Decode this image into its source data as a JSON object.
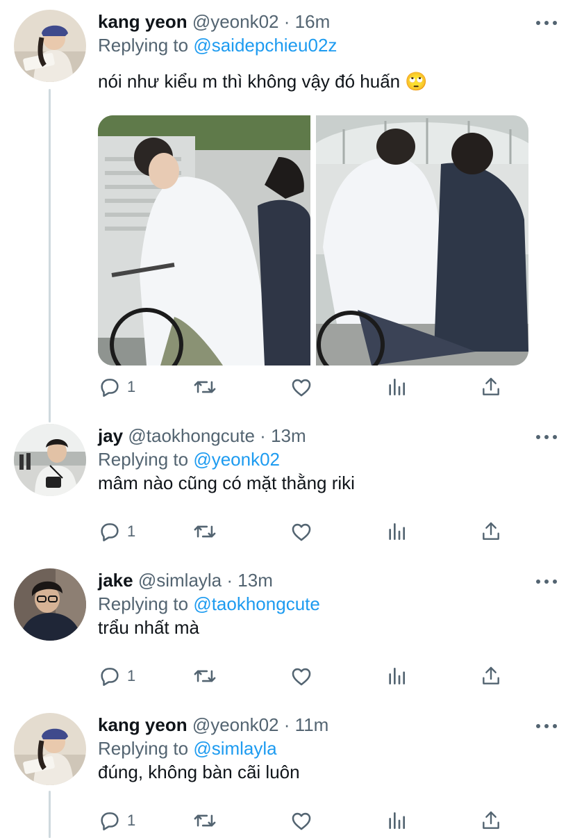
{
  "tweets": [
    {
      "name": "kang yeon",
      "handle": "@yeonk02",
      "time": "16m",
      "replying_label": "Replying to",
      "replying_to": "@saidepchieu02z",
      "text": "nói như kiểu m thì không vậy đó huấn 🙄",
      "reply_count": "1",
      "has_media": true
    },
    {
      "name": "jay",
      "handle": "@taokhongcute",
      "time": "13m",
      "replying_label": "Replying to",
      "replying_to": "@yeonk02",
      "text": "mâm nào cũng có mặt thằng riki",
      "reply_count": "1"
    },
    {
      "name": "jake",
      "handle": "@simlayla",
      "time": "13m",
      "replying_label": "Replying to",
      "replying_to": "@taokhongcute",
      "text": "trẩu nhất mà",
      "reply_count": "1"
    },
    {
      "name": "kang yeon",
      "handle": "@yeonk02",
      "time": "11m",
      "replying_label": "Replying to",
      "replying_to": "@simlayla",
      "text": "đúng, không bàn cãi luôn",
      "reply_count": "1"
    }
  ],
  "separator": "·",
  "colors": {
    "link": "#1d9bf0",
    "secondary_text": "#536471",
    "primary_text": "#0f1419",
    "thread_line": "#cfd9de"
  },
  "icons": [
    "reply-icon",
    "retweet-icon",
    "like-icon",
    "analytics-icon",
    "share-icon",
    "more-icon"
  ]
}
